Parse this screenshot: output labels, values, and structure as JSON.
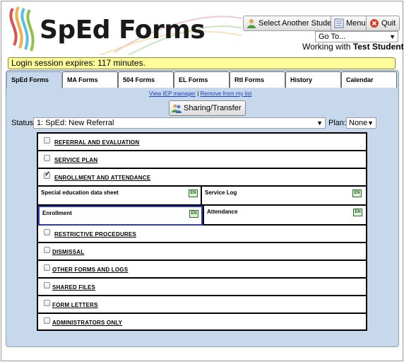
{
  "app": {
    "title": "SpEd Forms"
  },
  "header": {
    "select_student_label": "Select Another Student",
    "menu_label": "Menu",
    "quit_label": "Quit",
    "goto_value": "Go To...",
    "working_prefix": "Working with",
    "student_name": "Test Student"
  },
  "session": {
    "text": "Login session expires: 117 minutes."
  },
  "tabs": [
    {
      "label": "SpEd Forms",
      "active": true
    },
    {
      "label": "MA Forms"
    },
    {
      "label": "504 Forms"
    },
    {
      "label": "EL Forms"
    },
    {
      "label": "RtI Forms"
    },
    {
      "label": "History"
    },
    {
      "label": "Calendar"
    }
  ],
  "links": {
    "view_iep": "View IEP manager",
    "separator": "|",
    "remove": "Remove from my list"
  },
  "sharing_label": "Sharing/Transfer",
  "status": {
    "label": "Status:",
    "value": "1: SpEd: New Referral",
    "plan_label": "Plan:",
    "plan_value": "None"
  },
  "sections": [
    {
      "label": "REFERRAL AND EVALUATION",
      "checked": false
    },
    {
      "label": "SERVICE PLAN",
      "checked": false
    },
    {
      "label": "ENROLLMENT AND ATTENDANCE",
      "checked": true
    },
    {
      "label": "RESTRICTIVE PROCEDURES",
      "checked": false
    },
    {
      "label": "DISMISSAL",
      "checked": false
    },
    {
      "label": "OTHER FORMS AND LOGS",
      "checked": false
    },
    {
      "label": "SHARED FILES",
      "checked": false
    },
    {
      "label": "FORM LETTERS",
      "checked": false
    },
    {
      "label": "ADMINISTRATORS ONLY",
      "checked": false
    }
  ],
  "forms": [
    {
      "label": "Special education data sheet",
      "badge": "EN"
    },
    {
      "label": "Service Log",
      "badge": "EN"
    },
    {
      "label": "Enrollment",
      "badge": "EN",
      "selected": true
    },
    {
      "label": "Attendance",
      "badge": "EN"
    }
  ],
  "colors": {
    "panel_bg": "#c8d8ec",
    "session_bg": "#fefb9a",
    "link": "#1a40c0",
    "selected_border": "#2b3bbf"
  }
}
